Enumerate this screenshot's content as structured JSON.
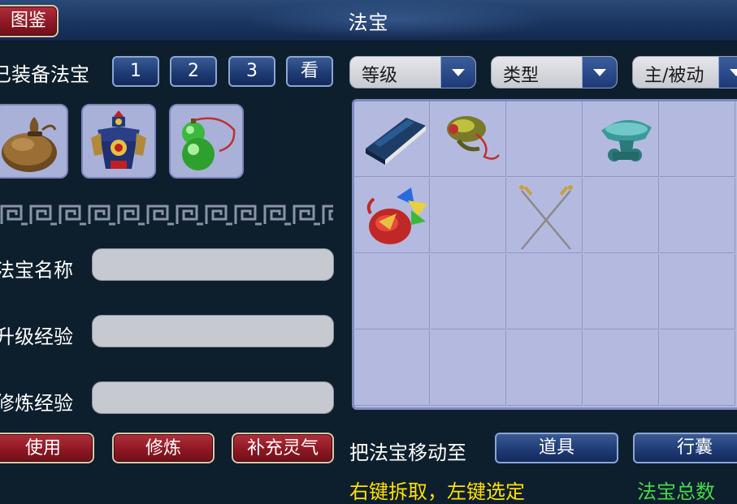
{
  "window": {
    "title": "法宝"
  },
  "top_left_button": {
    "label": "图鉴"
  },
  "equipped": {
    "label": "已装备法宝",
    "tabs": [
      "1",
      "2",
      "3"
    ],
    "view_button": "看",
    "slots": [
      {
        "icon": "money-bag-icon"
      },
      {
        "icon": "armored-warrior-icon"
      },
      {
        "icon": "green-gourd-icon"
      }
    ]
  },
  "filters": [
    {
      "label": "等级"
    },
    {
      "label": "类型"
    },
    {
      "label": "主/被动"
    }
  ],
  "fields": [
    {
      "label": "法宝名称",
      "value": ""
    },
    {
      "label": "升级经验",
      "value": ""
    },
    {
      "label": "修炼经验",
      "value": ""
    }
  ],
  "inventory": {
    "items": [
      {
        "row": 0,
        "col": 0,
        "icon": "blue-book-icon"
      },
      {
        "row": 0,
        "col": 1,
        "icon": "gourd-rope-icon"
      },
      {
        "row": 0,
        "col": 3,
        "icon": "jade-cauldron-icon"
      },
      {
        "row": 1,
        "col": 0,
        "icon": "flag-charm-icon"
      },
      {
        "row": 1,
        "col": 2,
        "icon": "crossed-swords-icon"
      }
    ]
  },
  "actions": {
    "use": "使用",
    "refine": "修炼",
    "replenish": "补充灵气"
  },
  "move_to": {
    "label": "把法宝移动至",
    "item_button": "道具",
    "bag_button": "行囊"
  },
  "footer": {
    "hint": "右键拆取，左键选定",
    "total": "法宝总数"
  },
  "colors": {
    "background": "#0d1f2d",
    "panel": "#b4badf",
    "hint_yellow": "#ffe000",
    "total_green": "#46d84a"
  }
}
